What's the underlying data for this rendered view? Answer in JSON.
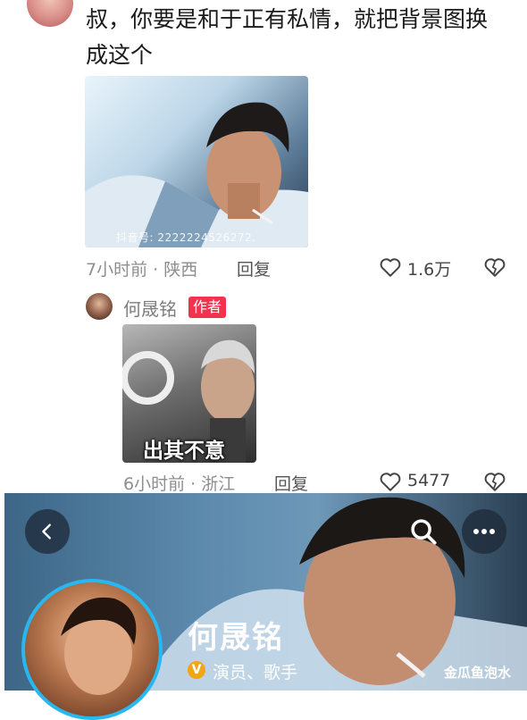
{
  "comment": {
    "text": "叔，你要是和于正有私情，就把背景图换成这个",
    "watermark": "抖音号: 2222224526272.",
    "time_location": "7小时前 · 陕西",
    "reply_label": "回复",
    "likes": "1.6万"
  },
  "reply": {
    "user_name": "何晟铭",
    "badge": "作者",
    "image_caption": "出其不意",
    "time_location": "6小时前 · 浙江",
    "reply_label": "回复",
    "likes": "5477"
  },
  "profile": {
    "name": "何晟铭",
    "verified_tag": "演员、歌手",
    "verified_icon": "V",
    "site_watermark": "金瓜鱼泡水",
    "accent_color": "#29b7f0"
  },
  "icons": [
    "back-icon",
    "search-icon",
    "more-icon",
    "heart-icon",
    "dislike-heart-icon"
  ]
}
